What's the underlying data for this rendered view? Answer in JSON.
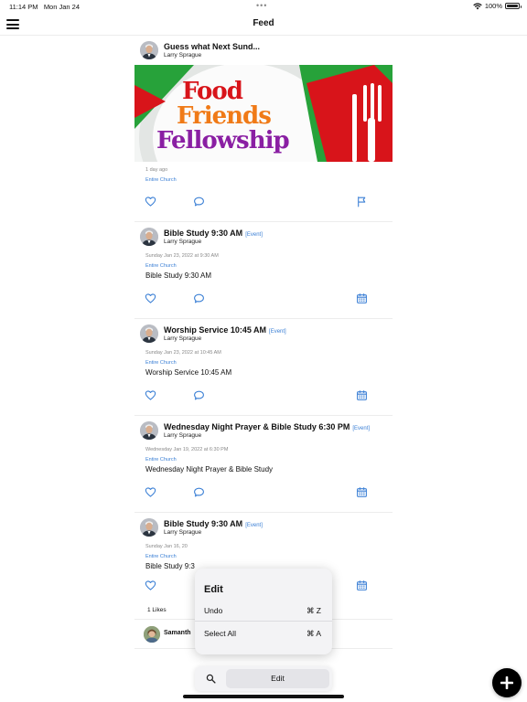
{
  "status_bar": {
    "time": "11:14 PM",
    "date": "Mon Jan 24",
    "dots": "•••",
    "battery": "100%"
  },
  "navbar": {
    "title": "Feed",
    "menu_icon": "hamburger-menu-icon"
  },
  "posts": [
    {
      "title": "Guess what Next Sund...",
      "author": "Larry Sprague",
      "image_text": [
        "Food",
        "Friends",
        "Fellowship"
      ],
      "meta": "1 day ago",
      "group": "Entire Church"
    },
    {
      "title": "Bible Study 9:30 AM",
      "tag": "[Event]",
      "author": "Larry Sprague",
      "meta": "Sunday Jan 23, 2022 at 9:30 AM",
      "group": "Entire Church",
      "body": "Bible Study 9:30 AM"
    },
    {
      "title": "Worship Service 10:45 AM",
      "tag": "[Event]",
      "author": "Larry Sprague",
      "meta": "Sunday Jan 23, 2022 at 10:45 AM",
      "group": "Entire Church",
      "body": "Worship Service 10:45 AM"
    },
    {
      "title": "Wednesday Night Prayer & Bible Study 6:30 PM",
      "tag": "[Event]",
      "author": "Larry Sprague",
      "meta": "Wednesday Jan 19, 2022 at 6:30 PM",
      "group": "Entire Church",
      "body": "Wednesday Night Prayer & Bible Study"
    },
    {
      "title": "Bible Study 9:30 AM",
      "tag": "[Event]",
      "author": "Larry Sprague",
      "meta": "Sunday Jan 16, 20",
      "group": "Entire Church",
      "body": "Bible Study 9:3",
      "likes": "1 Likes",
      "commenter": "Samanth"
    }
  ],
  "edit_menu": {
    "title": "Edit",
    "items": [
      {
        "label": "Undo",
        "shortcut": "⌘ Z"
      },
      {
        "label": "Select All",
        "shortcut": "⌘ A"
      }
    ]
  },
  "find_bar": {
    "edit_label": "Edit"
  },
  "colors": {
    "accent": "#3a7fd5",
    "food": "#d8141a",
    "friends": "#f07a17",
    "fellowship": "#8a1fa3",
    "fab": "#000000"
  }
}
